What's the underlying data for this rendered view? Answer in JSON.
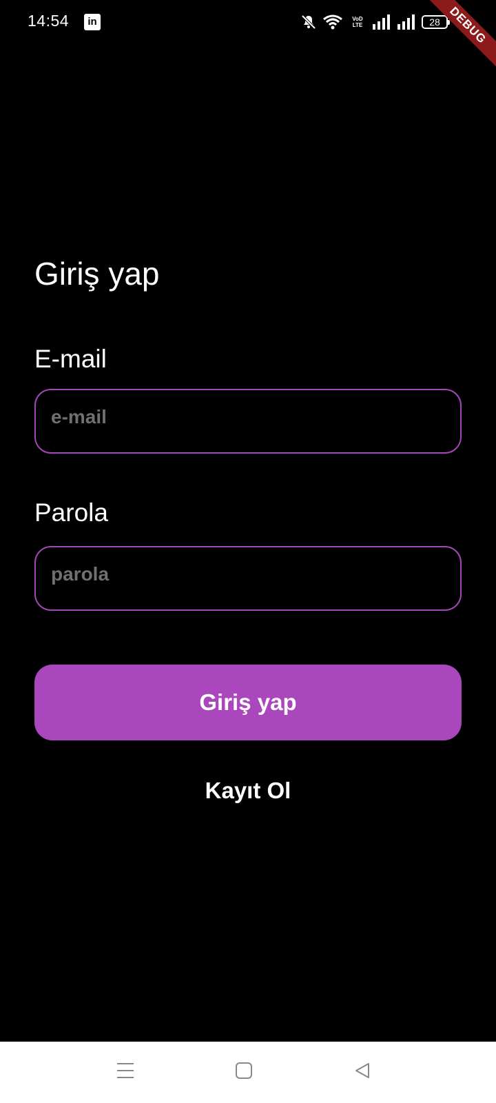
{
  "status_bar": {
    "time": "14:54",
    "app_icon_text": "in",
    "network_type": "VoD LTE",
    "battery_level": "28"
  },
  "debug_banner": "DEBUG",
  "login_form": {
    "title": "Giriş yap",
    "email_label": "E-mail",
    "email_placeholder": "e-mail",
    "email_value": "",
    "password_label": "Parola",
    "password_placeholder": "parola",
    "password_value": "",
    "login_button_label": "Giriş yap",
    "register_link_label": "Kayıt Ol"
  },
  "colors": {
    "accent": "#ab47bc",
    "input_border": "#a246b8",
    "background": "#000000",
    "placeholder": "#707070",
    "debug_ribbon": "#8b1a1a"
  },
  "navigation_bar": {
    "icons": [
      "menu-icon",
      "home-icon",
      "back-icon"
    ]
  }
}
